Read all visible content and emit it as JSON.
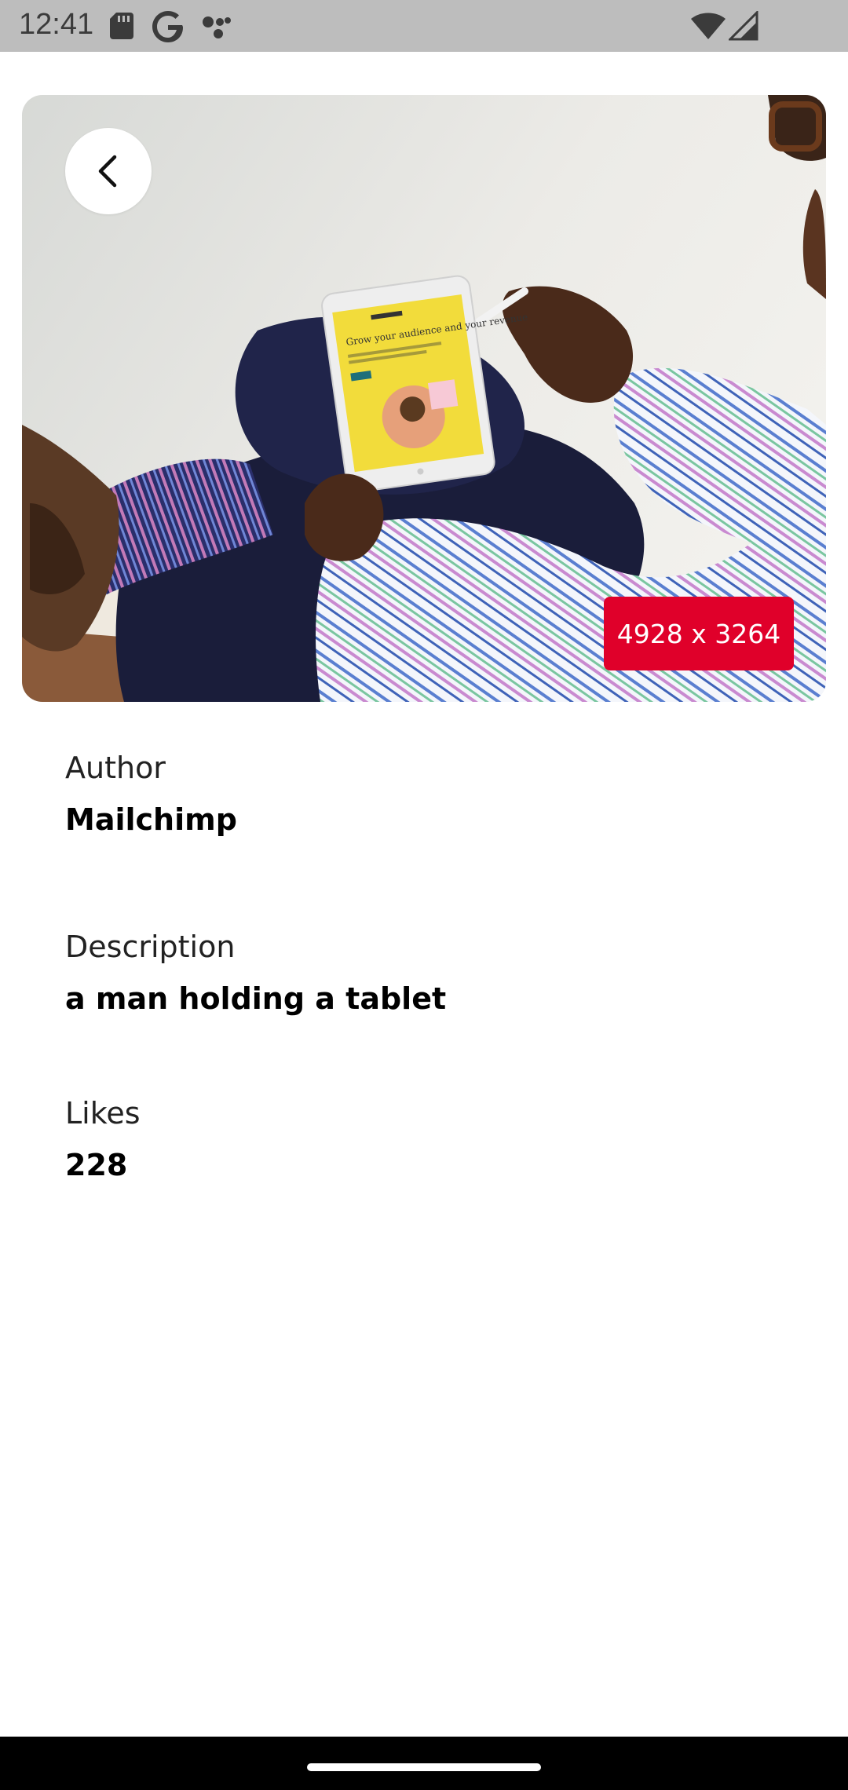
{
  "status_bar": {
    "time": "12:41",
    "icons": [
      "sd-card-icon",
      "google-icon",
      "assistant-dots-icon",
      "wifi-icon",
      "cell-signal-icon"
    ]
  },
  "photo": {
    "dimensions_label": "4928 x 3264",
    "badge_color": "#e0002a",
    "tablet_headline": "Grow your audience and your revenue"
  },
  "details": {
    "author_label": "Author",
    "author_value": "Mailchimp",
    "description_label": "Description",
    "description_value": "a man holding a tablet",
    "likes_label": "Likes",
    "likes_value": "228"
  }
}
